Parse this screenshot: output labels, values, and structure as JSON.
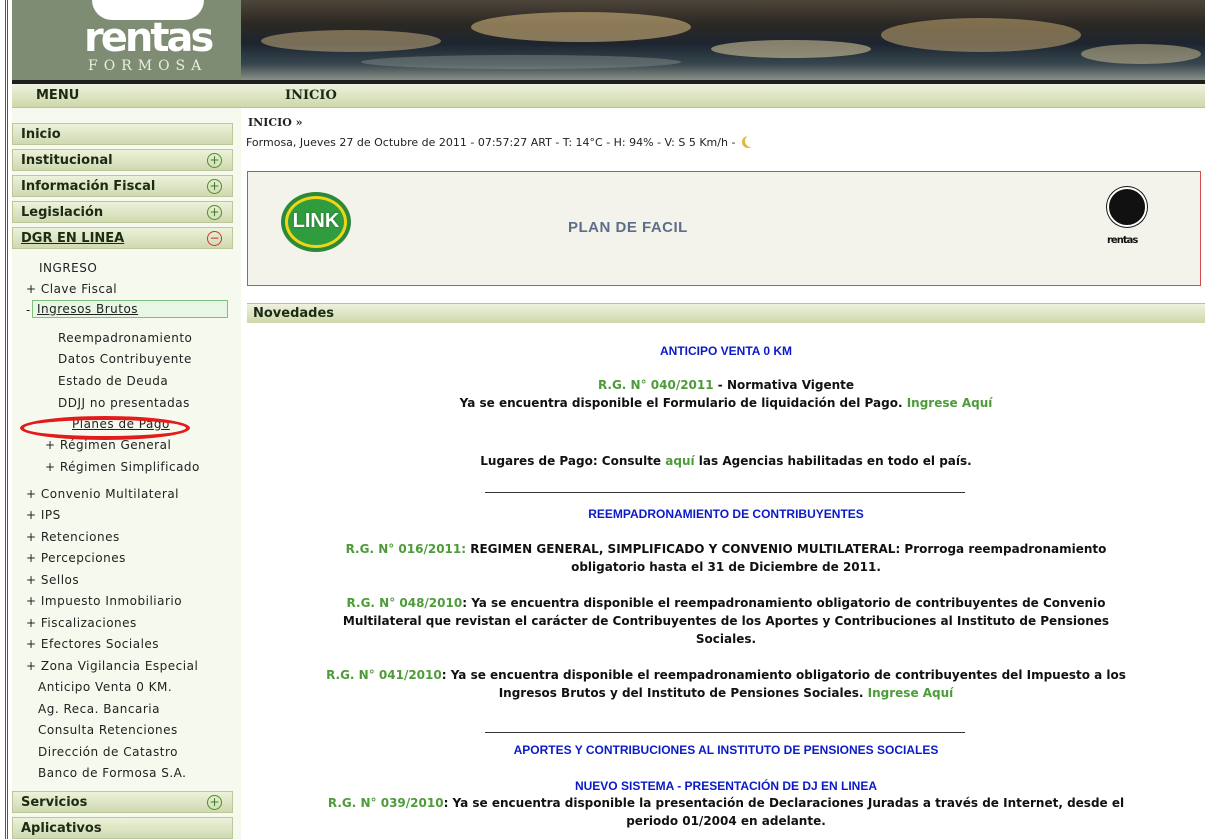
{
  "brand": {
    "wordmark": "rentas",
    "region": "FORMOSA"
  },
  "header": {
    "menu_label": "MENU",
    "section_title": "INICIO"
  },
  "breadcrumb": {
    "label": "INICIO »"
  },
  "status_line": "Formosa, Jueves 27 de Octubre de 2011 - 07:57:27 ART - T: 14°C - H: 94% - V: S 5 Km/h -",
  "nav": {
    "inicio": "Inicio",
    "institucional": "Institucional",
    "info_fiscal": "Información Fiscal",
    "legislacion": "Legislación",
    "dgr": "DGR EN LINEA",
    "servicios": "Servicios",
    "aplicativos": "Aplicativos",
    "toggle_plus": "+",
    "toggle_minus": "−"
  },
  "dgr_items": {
    "ingreso": "INGRESO",
    "clave_fiscal": "+ Clave Fiscal",
    "ingresos_brutos": "Ingresos Brutos",
    "ib_prefix": "-",
    "reempadronamiento": "Reempadronamiento",
    "datos": "Datos Contribuyente",
    "estado": "Estado de Deuda",
    "ddjj": "DDJJ no presentadas",
    "planes": "Planes de Pago",
    "regimen_general": "+ Régimen General",
    "regimen_simplificado": "+ Régimen Simplificado",
    "convenio": "+ Convenio Multilateral",
    "ips": "+ IPS",
    "retenciones": "+ Retenciones",
    "percepciones": "+ Percepciones",
    "sellos": "+ Sellos",
    "inmobiliario": "+ Impuesto Inmobiliario",
    "fiscalizaciones": "+ Fiscalizaciones",
    "efectores": "+ Efectores Sociales",
    "zona": "+ Zona Vigilancia Especial",
    "anticipo": "Anticipo Venta 0 KM.",
    "ag_reca": "Ag. Reca. Bancaria",
    "consulta_ret": "Consulta Retenciones",
    "catastro": "Dirección de Catastro",
    "banco": "Banco de Formosa S.A."
  },
  "promo": {
    "link_logo": "LINK",
    "text": "PLAN DE FACIL",
    "seal": "rentas"
  },
  "novedades_title": "Novedades",
  "news": {
    "anticipo_title": "ANTICIPO VENTA 0 KM",
    "rg040": "R.G. N° 040/2011",
    "rg040_tail": " - Normativa Vigente",
    "rg040_line2": "Ya se encuentra disponible el Formulario de liquidación del Pago. ",
    "ingrese": "Ingrese Aquí",
    "lugares_pre": "Lugares de Pago: Consulte ",
    "aqui": "aquí",
    "lugares_post": " las Agencias habilitadas en todo el país.",
    "reemp_title": "REEMPADRONAMIENTO DE CONTRIBUYENTES",
    "rg016": "R.G. N° 016/2011:",
    "rg016_text": " REGIMEN GENERAL, SIMPLIFICADO Y CONVENIO MULTILATERAL: Prorroga reempadronamiento",
    "rg016_line2": "obligatorio hasta el 31 de Diciembre de 2011.",
    "rg048": "R.G. N° 048/2010",
    "rg048_text": ": Ya se encuentra disponible el reempadronamiento obligatorio de contribuyentes de Convenio",
    "rg048_line2": "Multilateral que revistan el carácter de Contribuyentes de los Aportes y Contribuciones al Instituto de Pensiones",
    "rg048_line3": "Sociales.",
    "rg041": "R.G. N° 041/2010",
    "rg041_text": ": Ya se encuentra disponible el reempadronamiento obligatorio de contribuyentes del Impuesto a los",
    "rg041_line2": "Ingresos Brutos y del Instituto de Pensiones Sociales. ",
    "aportes_title": "APORTES Y CONTRIBUCIONES AL INSTITUTO DE PENSIONES SOCIALES",
    "nuevo_title": "NUEVO SISTEMA - PRESENTACIÓN DE DJ EN LINEA",
    "rg039": "R.G. N° 039/2010",
    "rg039_text": ": Ya se encuentra disponible la presentación de Declaraciones Juradas a través de Internet, desde el",
    "rg039_line2": "periodo 01/2004 en adelante."
  }
}
